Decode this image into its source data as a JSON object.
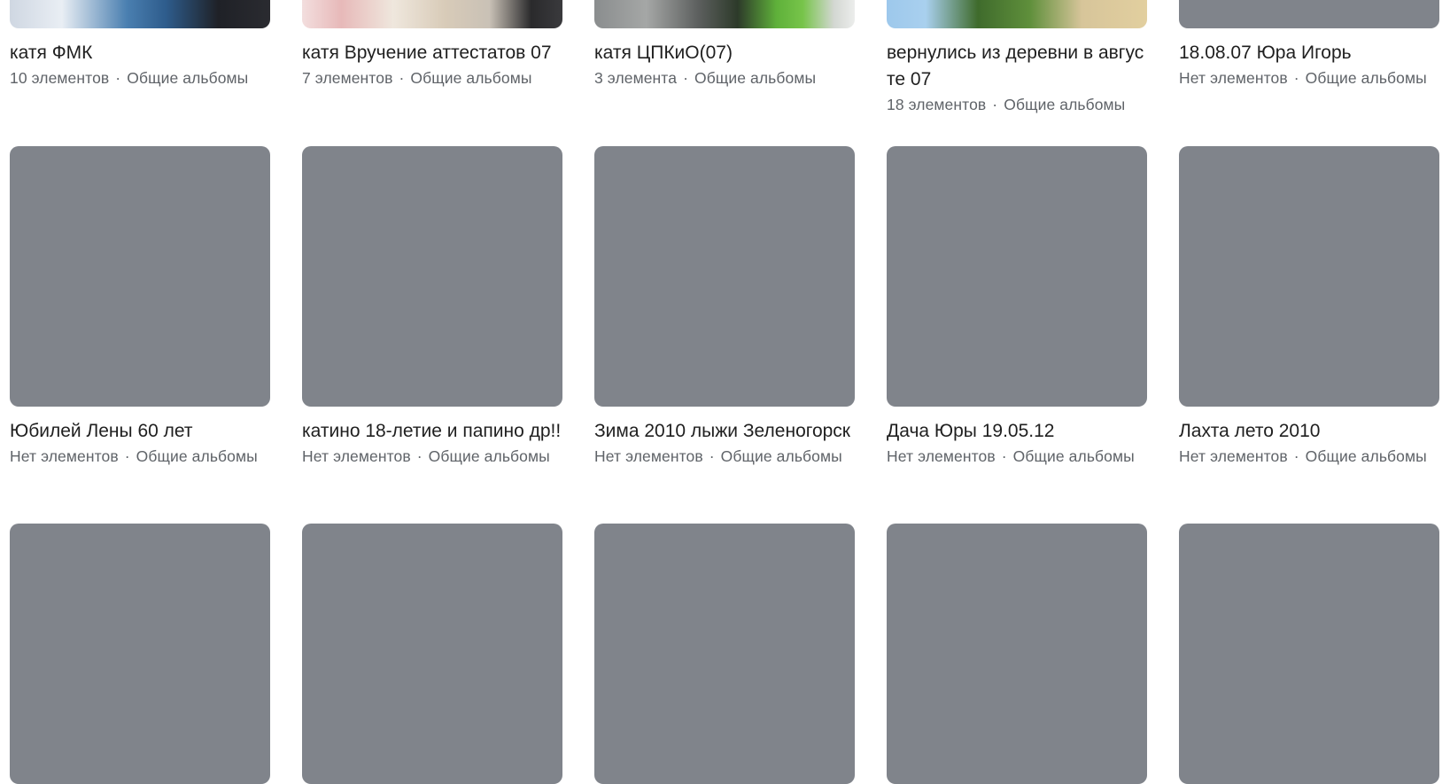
{
  "albums": [
    {
      "title": "катя ФМК",
      "count": "10 элементов",
      "category": "Общие альбомы"
    },
    {
      "title": "катя Вручение аттестатов 07",
      "count": "7 элементов",
      "category": "Общие альбомы"
    },
    {
      "title": "катя ЦПКиО(07)",
      "count": "3 элемента",
      "category": "Общие альбомы"
    },
    {
      "title": "вернулись из деревни в августе 07",
      "count": "18 элементов",
      "category": "Общие альбомы"
    },
    {
      "title": "18.08.07 Юра Игорь",
      "count": "Нет элементов",
      "category": "Общие альбомы"
    },
    {
      "title": "Юбилей Лены 60 лет",
      "count": "Нет элементов",
      "category": "Общие альбомы"
    },
    {
      "title": "катино 18-летие и папино др!!",
      "count": "Нет элементов",
      "category": "Общие альбомы"
    },
    {
      "title": "Зима 2010 лыжи Зеленогорск",
      "count": "Нет элементов",
      "category": "Общие альбомы"
    },
    {
      "title": "Дача Юры 19.05.12",
      "count": "Нет элементов",
      "category": "Общие альбомы"
    },
    {
      "title": "Лахта лето 2010",
      "count": "Нет элементов",
      "category": "Общие альбомы"
    },
    {
      "title": "",
      "count": "",
      "category": ""
    },
    {
      "title": "",
      "count": "",
      "category": ""
    },
    {
      "title": "",
      "count": "",
      "category": ""
    },
    {
      "title": "",
      "count": "",
      "category": ""
    },
    {
      "title": "",
      "count": "",
      "category": ""
    }
  ],
  "meta_separator": "·",
  "colors": {
    "placeholder": "#80848b",
    "title": "#1f1f1f",
    "meta": "#5f6368"
  }
}
